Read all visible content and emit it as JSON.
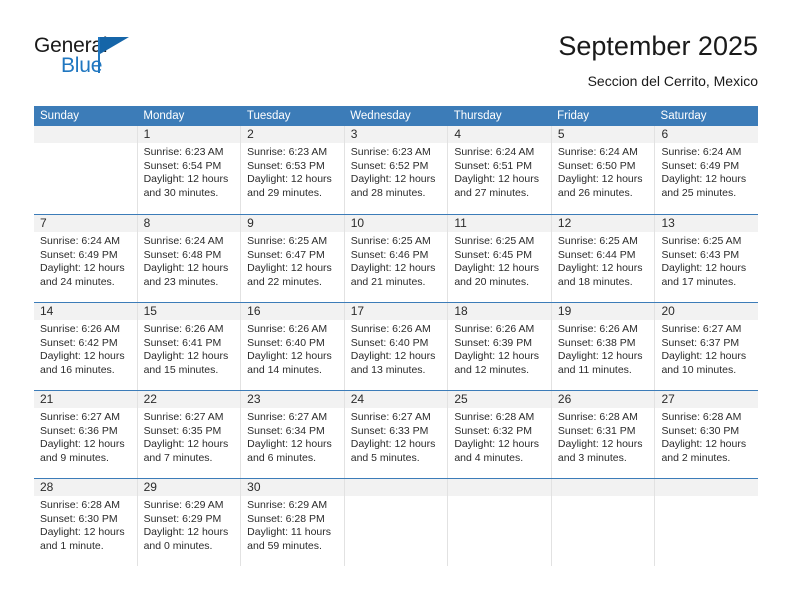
{
  "logo": {
    "word_one": "General",
    "word_two": "Blue",
    "accent_color": "#2077c0",
    "triangle_color": "#1565a8"
  },
  "header": {
    "title": "September 2025",
    "subtitle": "Seccion del Cerrito, Mexico"
  },
  "calendar": {
    "header_bg": "#3c7cb8",
    "weekdays": [
      "Sunday",
      "Monday",
      "Tuesday",
      "Wednesday",
      "Thursday",
      "Friday",
      "Saturday"
    ],
    "weeks": [
      [
        {
          "empty": true
        },
        {
          "day": "1",
          "sunrise": "Sunrise: 6:23 AM",
          "sunset": "Sunset: 6:54 PM",
          "daylight": "Daylight: 12 hours and 30 minutes."
        },
        {
          "day": "2",
          "sunrise": "Sunrise: 6:23 AM",
          "sunset": "Sunset: 6:53 PM",
          "daylight": "Daylight: 12 hours and 29 minutes."
        },
        {
          "day": "3",
          "sunrise": "Sunrise: 6:23 AM",
          "sunset": "Sunset: 6:52 PM",
          "daylight": "Daylight: 12 hours and 28 minutes."
        },
        {
          "day": "4",
          "sunrise": "Sunrise: 6:24 AM",
          "sunset": "Sunset: 6:51 PM",
          "daylight": "Daylight: 12 hours and 27 minutes."
        },
        {
          "day": "5",
          "sunrise": "Sunrise: 6:24 AM",
          "sunset": "Sunset: 6:50 PM",
          "daylight": "Daylight: 12 hours and 26 minutes."
        },
        {
          "day": "6",
          "sunrise": "Sunrise: 6:24 AM",
          "sunset": "Sunset: 6:49 PM",
          "daylight": "Daylight: 12 hours and 25 minutes."
        }
      ],
      [
        {
          "day": "7",
          "sunrise": "Sunrise: 6:24 AM",
          "sunset": "Sunset: 6:49 PM",
          "daylight": "Daylight: 12 hours and 24 minutes."
        },
        {
          "day": "8",
          "sunrise": "Sunrise: 6:24 AM",
          "sunset": "Sunset: 6:48 PM",
          "daylight": "Daylight: 12 hours and 23 minutes."
        },
        {
          "day": "9",
          "sunrise": "Sunrise: 6:25 AM",
          "sunset": "Sunset: 6:47 PM",
          "daylight": "Daylight: 12 hours and 22 minutes."
        },
        {
          "day": "10",
          "sunrise": "Sunrise: 6:25 AM",
          "sunset": "Sunset: 6:46 PM",
          "daylight": "Daylight: 12 hours and 21 minutes."
        },
        {
          "day": "11",
          "sunrise": "Sunrise: 6:25 AM",
          "sunset": "Sunset: 6:45 PM",
          "daylight": "Daylight: 12 hours and 20 minutes."
        },
        {
          "day": "12",
          "sunrise": "Sunrise: 6:25 AM",
          "sunset": "Sunset: 6:44 PM",
          "daylight": "Daylight: 12 hours and 18 minutes."
        },
        {
          "day": "13",
          "sunrise": "Sunrise: 6:25 AM",
          "sunset": "Sunset: 6:43 PM",
          "daylight": "Daylight: 12 hours and 17 minutes."
        }
      ],
      [
        {
          "day": "14",
          "sunrise": "Sunrise: 6:26 AM",
          "sunset": "Sunset: 6:42 PM",
          "daylight": "Daylight: 12 hours and 16 minutes."
        },
        {
          "day": "15",
          "sunrise": "Sunrise: 6:26 AM",
          "sunset": "Sunset: 6:41 PM",
          "daylight": "Daylight: 12 hours and 15 minutes."
        },
        {
          "day": "16",
          "sunrise": "Sunrise: 6:26 AM",
          "sunset": "Sunset: 6:40 PM",
          "daylight": "Daylight: 12 hours and 14 minutes."
        },
        {
          "day": "17",
          "sunrise": "Sunrise: 6:26 AM",
          "sunset": "Sunset: 6:40 PM",
          "daylight": "Daylight: 12 hours and 13 minutes."
        },
        {
          "day": "18",
          "sunrise": "Sunrise: 6:26 AM",
          "sunset": "Sunset: 6:39 PM",
          "daylight": "Daylight: 12 hours and 12 minutes."
        },
        {
          "day": "19",
          "sunrise": "Sunrise: 6:26 AM",
          "sunset": "Sunset: 6:38 PM",
          "daylight": "Daylight: 12 hours and 11 minutes."
        },
        {
          "day": "20",
          "sunrise": "Sunrise: 6:27 AM",
          "sunset": "Sunset: 6:37 PM",
          "daylight": "Daylight: 12 hours and 10 minutes."
        }
      ],
      [
        {
          "day": "21",
          "sunrise": "Sunrise: 6:27 AM",
          "sunset": "Sunset: 6:36 PM",
          "daylight": "Daylight: 12 hours and 9 minutes."
        },
        {
          "day": "22",
          "sunrise": "Sunrise: 6:27 AM",
          "sunset": "Sunset: 6:35 PM",
          "daylight": "Daylight: 12 hours and 7 minutes."
        },
        {
          "day": "23",
          "sunrise": "Sunrise: 6:27 AM",
          "sunset": "Sunset: 6:34 PM",
          "daylight": "Daylight: 12 hours and 6 minutes."
        },
        {
          "day": "24",
          "sunrise": "Sunrise: 6:27 AM",
          "sunset": "Sunset: 6:33 PM",
          "daylight": "Daylight: 12 hours and 5 minutes."
        },
        {
          "day": "25",
          "sunrise": "Sunrise: 6:28 AM",
          "sunset": "Sunset: 6:32 PM",
          "daylight": "Daylight: 12 hours and 4 minutes."
        },
        {
          "day": "26",
          "sunrise": "Sunrise: 6:28 AM",
          "sunset": "Sunset: 6:31 PM",
          "daylight": "Daylight: 12 hours and 3 minutes."
        },
        {
          "day": "27",
          "sunrise": "Sunrise: 6:28 AM",
          "sunset": "Sunset: 6:30 PM",
          "daylight": "Daylight: 12 hours and 2 minutes."
        }
      ],
      [
        {
          "day": "28",
          "sunrise": "Sunrise: 6:28 AM",
          "sunset": "Sunset: 6:30 PM",
          "daylight": "Daylight: 12 hours and 1 minute."
        },
        {
          "day": "29",
          "sunrise": "Sunrise: 6:29 AM",
          "sunset": "Sunset: 6:29 PM",
          "daylight": "Daylight: 12 hours and 0 minutes."
        },
        {
          "day": "30",
          "sunrise": "Sunrise: 6:29 AM",
          "sunset": "Sunset: 6:28 PM",
          "daylight": "Daylight: 11 hours and 59 minutes."
        },
        {
          "empty": true
        },
        {
          "empty": true
        },
        {
          "empty": true
        },
        {
          "empty": true
        }
      ]
    ]
  }
}
